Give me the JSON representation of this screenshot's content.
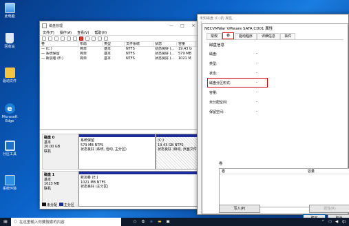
{
  "desktop": {
    "icons": [
      {
        "label": "此电脑"
      },
      {
        "label": "回收站"
      },
      {
        "label": "驱动文件"
      },
      {
        "label": "Microsoft Edge"
      },
      {
        "label": "分区工具"
      },
      {
        "label": "系统环境"
      }
    ]
  },
  "dm": {
    "title": "磁盘管理",
    "menu": [
      "文件(F)",
      "操作(A)",
      "查看(V)",
      "帮助(H)"
    ],
    "columns": [
      "卷",
      "布局",
      "类型",
      "文件系统",
      "状态",
      "容量"
    ],
    "rows": [
      [
        "— (C:)",
        "简单",
        "基本",
        "NTFS",
        "状态良好 (...",
        "19.43 G"
      ],
      [
        "— 系统保留",
        "简单",
        "基本",
        "NTFS",
        "状态良好 (...",
        "579 MB"
      ],
      [
        "— 新加卷 (E:)",
        "简单",
        "基本",
        "NTFS",
        "状态良好 (...",
        "1021 M"
      ]
    ],
    "disk0": {
      "name": "磁盘 0",
      "l1": "基本",
      "l2": "20.00 GB",
      "l3": "联机",
      "p1": {
        "name": "系统保留",
        "size": "579 MB NTFS",
        "status": "状态良好 (系统, 活动, 主分区)"
      },
      "p2": {
        "name": "(C:)",
        "size": "19.43 GB NTFS",
        "status": "状态良好 (启动, 页面文件, 故障转储, 主分区)"
      }
    },
    "disk1": {
      "name": "磁盘 1",
      "l1": "基本",
      "l2": "1023 MB",
      "l3": "联机",
      "p1": {
        "name": "新加卷 (E:)",
        "size": "1021 MB NTFS",
        "status": "状态良好 (主分区)"
      }
    },
    "legend": [
      "未分配",
      "主分区"
    ]
  },
  "props": {
    "titlebar": "未知磁盘 (C:)的 属性",
    "title": "NECVMWar VMware SATA CD01 属性",
    "tabs": [
      "常规",
      "卷",
      "驱动程序",
      "详细信息",
      "事件"
    ],
    "group": "磁盘信息",
    "fields": [
      {
        "k": "磁盘:",
        "v": "-"
      },
      {
        "k": "类型:",
        "v": "-"
      },
      {
        "k": "状态:",
        "v": "-"
      },
      {
        "k": "磁盘分区形式:",
        "v": "-"
      },
      {
        "k": "容量:",
        "v": "-"
      },
      {
        "k": "未分配空间:",
        "v": "-"
      },
      {
        "k": "保留空间:",
        "v": "-"
      }
    ],
    "volumes_label": "卷",
    "vol_cols": [
      "卷",
      "容量"
    ],
    "import": "写入(P)",
    "props_btn": "属性(R)",
    "ok": "确定",
    "cancel": "取消"
  },
  "taskbar": {
    "search": "在这里输入你要搜索的内容"
  }
}
